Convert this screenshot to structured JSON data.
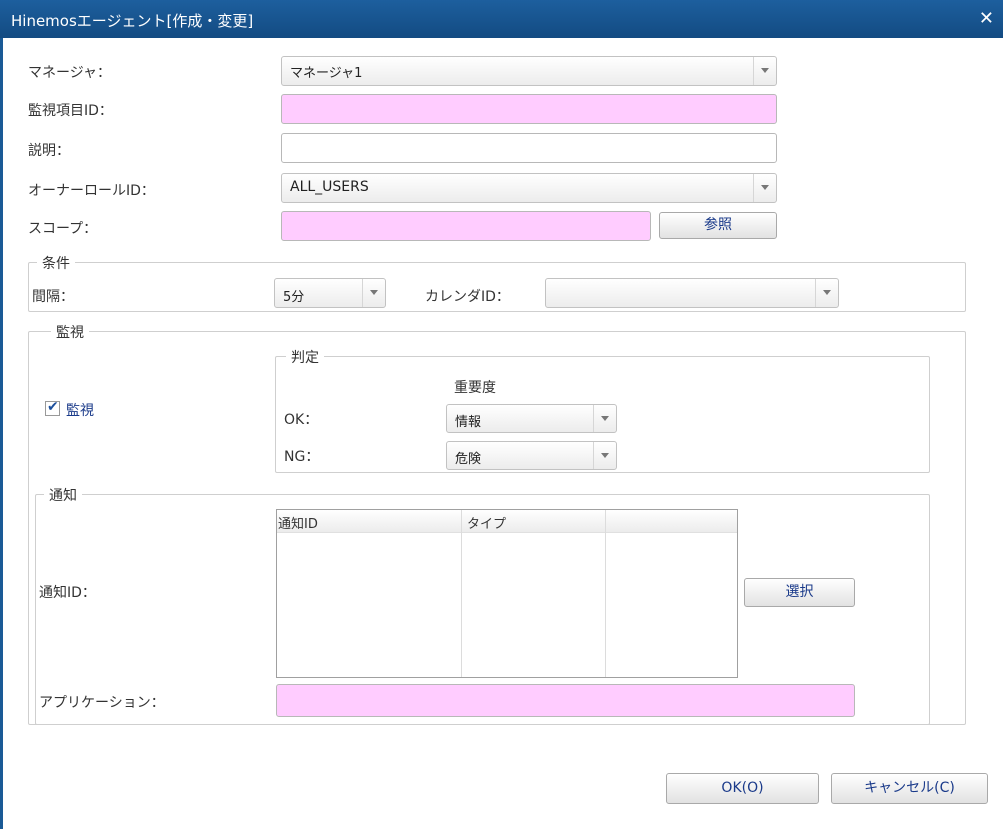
{
  "dialog": {
    "title": "Hinemosエージェント[作成・変更]",
    "close_glyph": "✕"
  },
  "form": {
    "manager_label": "マネージャ：",
    "manager_value": "マネージャ1",
    "monitor_id_label": "監視項目ID：",
    "monitor_id_value": "",
    "description_label": "説明：",
    "description_value": "",
    "owner_role_label": "オーナーロールID：",
    "owner_role_value": "ALL_USERS",
    "scope_label": "スコープ：",
    "scope_value": "",
    "reference_button": "参照"
  },
  "conditions": {
    "legend": "条件",
    "interval_label": "間隔：",
    "interval_value": "5分",
    "calendar_label": "カレンダID：",
    "calendar_value": ""
  },
  "monitoring": {
    "legend": "監視",
    "monitor_checkbox_label": "監視",
    "monitor_checked": true,
    "judgement": {
      "legend": "判定",
      "priority_header": "重要度",
      "ok_label": "OK：",
      "ok_value": "情報",
      "ng_label": "NG：",
      "ng_value": "危険"
    }
  },
  "notification": {
    "legend": "通知",
    "notify_id_label": "通知ID：",
    "columns": [
      "通知ID",
      "タイプ",
      ""
    ],
    "rows": [],
    "select_button": "選択",
    "application_label": "アプリケーション：",
    "application_value": ""
  },
  "footer": {
    "ok_button": "OK(O)",
    "cancel_button": "キャンセル(C)"
  },
  "colors": {
    "titlebar": "#1d5f9e",
    "required_field": "#ffccff",
    "button_text": "#1a3a8a"
  }
}
